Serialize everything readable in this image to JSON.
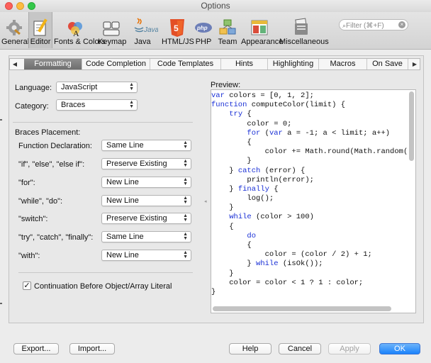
{
  "window": {
    "title": "Options"
  },
  "toolbar": {
    "items": [
      {
        "label": "General",
        "icon": "general-icon"
      },
      {
        "label": "Editor",
        "icon": "editor-icon"
      },
      {
        "label": "Fonts & Colors",
        "icon": "fonts-colors-icon"
      },
      {
        "label": "Keymap",
        "icon": "keymap-icon"
      },
      {
        "label": "Java",
        "icon": "java-icon"
      },
      {
        "label": "HTML/JS",
        "icon": "html5-icon"
      },
      {
        "label": "PHP",
        "icon": "php-icon"
      },
      {
        "label": "Team",
        "icon": "team-icon"
      },
      {
        "label": "Appearance",
        "icon": "appearance-icon"
      },
      {
        "label": "Miscellaneous",
        "icon": "miscellaneous-icon"
      }
    ],
    "selected": "Editor",
    "search_placeholder": "Filter (⌘+F)"
  },
  "tabs": {
    "items": [
      "Formatting",
      "Code Completion",
      "Code Templates",
      "Hints",
      "Highlighting",
      "Macros",
      "On Save"
    ],
    "active": "Formatting"
  },
  "form": {
    "language_label": "Language:",
    "language_value": "JavaScript",
    "category_label": "Category:",
    "category_value": "Braces",
    "section_title": "Braces Placement:",
    "rows": [
      {
        "label": "Function Declaration:",
        "value": "Same Line"
      },
      {
        "label": "\"if\", \"else\", \"else if\":",
        "value": "Preserve Existing"
      },
      {
        "label": "\"for\":",
        "value": "New Line"
      },
      {
        "label": "\"while\", \"do\":",
        "value": "New Line"
      },
      {
        "label": "\"switch\":",
        "value": "Preserve Existing"
      },
      {
        "label": "\"try\", \"catch\", \"finally\":",
        "value": "Same Line"
      },
      {
        "label": "\"with\":",
        "value": "New Line"
      }
    ],
    "continuation_label": "Continuation Before Object/Array Literal",
    "continuation_checked": true
  },
  "preview": {
    "label": "Preview:",
    "lines": [
      [
        [
          "kw",
          "var"
        ],
        [
          "t",
          " colors = [0, 1, 2];"
        ]
      ],
      [
        [
          "kw",
          "function"
        ],
        [
          "t",
          " computeColor(limit) {"
        ]
      ],
      [
        [
          "t",
          "    "
        ],
        [
          "kw",
          "try"
        ],
        [
          "t",
          " {"
        ]
      ],
      [
        [
          "t",
          "        color = 0;"
        ]
      ],
      [
        [
          "t",
          "        "
        ],
        [
          "kw",
          "for"
        ],
        [
          "t",
          " ("
        ],
        [
          "kw",
          "var"
        ],
        [
          "t",
          " a = -1; a < limit; a++)"
        ]
      ],
      [
        [
          "t",
          "        {"
        ]
      ],
      [
        [
          "t",
          "            color += Math.round(Math.random("
        ]
      ],
      [
        [
          "t",
          "        }"
        ]
      ],
      [
        [
          "t",
          "    } "
        ],
        [
          "kw",
          "catch"
        ],
        [
          "t",
          " (error) {"
        ]
      ],
      [
        [
          "t",
          "        println(error);"
        ]
      ],
      [
        [
          "t",
          "    } "
        ],
        [
          "kw",
          "finally"
        ],
        [
          "t",
          " {"
        ]
      ],
      [
        [
          "t",
          "        log();"
        ]
      ],
      [
        [
          "t",
          "    }"
        ]
      ],
      [
        [
          "t",
          "    "
        ],
        [
          "kw",
          "while"
        ],
        [
          "t",
          " (color > 100)"
        ]
      ],
      [
        [
          "t",
          "    {"
        ]
      ],
      [
        [
          "t",
          "        "
        ],
        [
          "kw",
          "do"
        ]
      ],
      [
        [
          "t",
          "        {"
        ]
      ],
      [
        [
          "t",
          "            color = (color / 2) + 1;"
        ]
      ],
      [
        [
          "t",
          "        } "
        ],
        [
          "kw",
          "while"
        ],
        [
          "t",
          " (isOk());"
        ]
      ],
      [
        [
          "t",
          "    }"
        ]
      ],
      [
        [
          "t",
          "    color = color < 1 ? 1 : color;"
        ]
      ],
      [
        [
          "t",
          "}"
        ]
      ]
    ]
  },
  "buttons": {
    "export": "Export...",
    "import": "Import...",
    "help": "Help",
    "cancel": "Cancel",
    "apply": "Apply",
    "ok": "OK"
  },
  "colors": {
    "keyword": "#1a30d6",
    "primary_button": "#1a82fb",
    "html5": "#e34f26",
    "php": "#6c7eb7"
  }
}
